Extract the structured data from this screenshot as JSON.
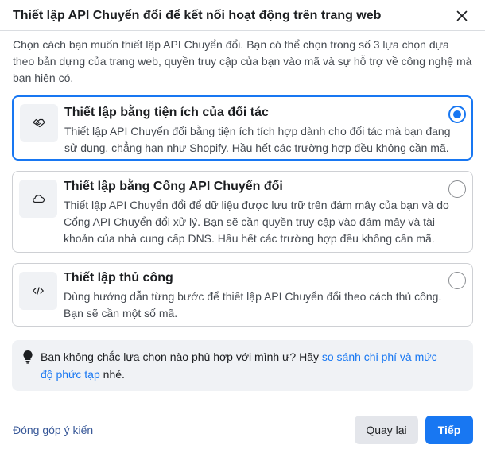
{
  "dialog": {
    "title": "Thiết lập API Chuyển đổi để kết nối hoạt động trên trang web",
    "description": "Chọn cách bạn muốn thiết lập API Chuyển đổi. Bạn có thể chọn trong số 3 lựa chọn dựa theo bản dựng của trang web, quyền truy cập của bạn vào mã và sự hỗ trợ về công nghệ mà bạn hiện có."
  },
  "options": [
    {
      "icon": "handshake-icon",
      "title": "Thiết lập bằng tiện ích của đối tác",
      "description": "Thiết lập API Chuyển đổi bằng tiện ích tích hợp dành cho đối tác mà bạn đang sử dụng, chẳng hạn như Shopify. Hầu hết các trường hợp đều không cần mã.",
      "selected": true
    },
    {
      "icon": "cloud-icon",
      "title": "Thiết lập bằng Cổng API Chuyển đổi",
      "description": "Thiết lập API Chuyển đổi để dữ liệu được lưu trữ trên đám mây của bạn và do Cổng API Chuyển đổi xử lý. Bạn sẽ cần quyền truy cập vào đám mây và tài khoản của nhà cung cấp DNS. Hầu hết các trường hợp đều không cần mã.",
      "selected": false
    },
    {
      "icon": "code-icon",
      "title": "Thiết lập thủ công",
      "description": "Dùng hướng dẫn từng bước để thiết lập API Chuyển đổi theo cách thủ công. Bạn sẽ cần một số mã.",
      "selected": false
    }
  ],
  "tip": {
    "icon": "lightbulb-icon",
    "text_before": "Bạn không chắc lựa chọn nào phù hợp với mình ư? Hãy ",
    "link": "so sánh chi phí và mức độ phức tạp",
    "text_after": " nhé."
  },
  "footer": {
    "feedback_link": "Đóng góp ý kiến",
    "back_label": "Quay lại",
    "next_label": "Tiếp"
  },
  "colors": {
    "accent": "#1877f2",
    "link": "#385898",
    "tip_background": "#f0f2f5"
  }
}
